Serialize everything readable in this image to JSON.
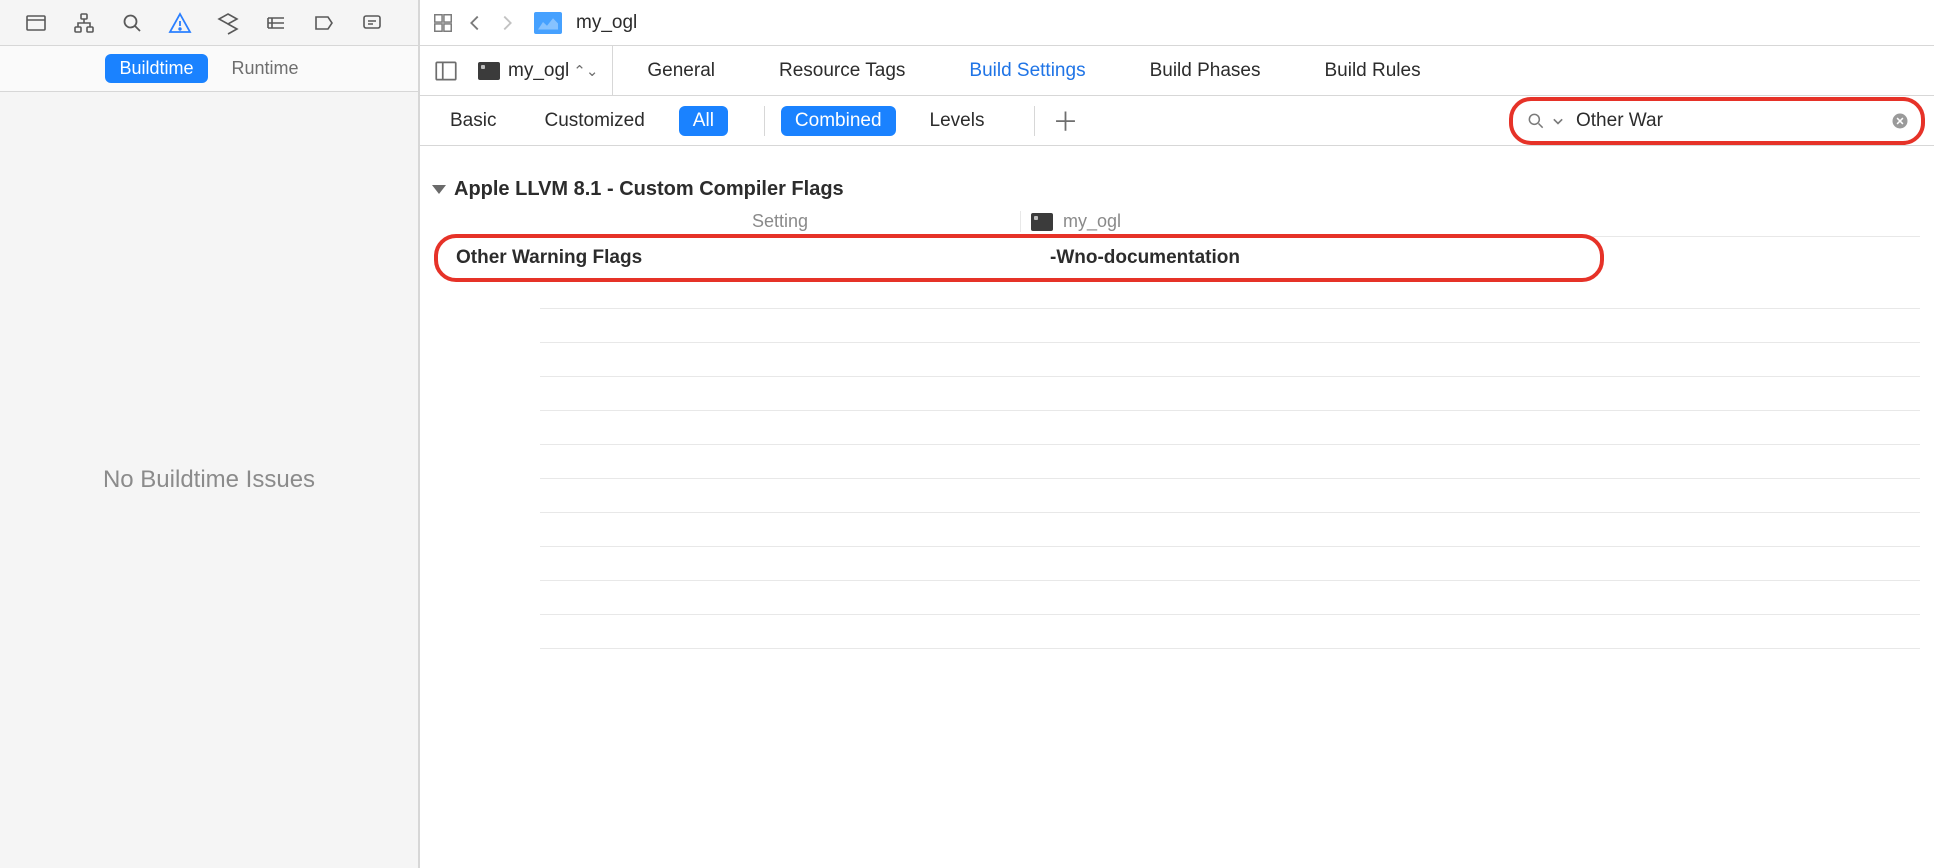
{
  "sidebar": {
    "segments": {
      "buildtime": "Buildtime",
      "runtime": "Runtime"
    },
    "active_segment": "buildtime",
    "message": "No Buildtime Issues"
  },
  "breadcrumb": {
    "file": "my_ogl"
  },
  "target": {
    "name": "my_ogl"
  },
  "project_tabs": {
    "general": "General",
    "resource_tags": "Resource Tags",
    "build_settings": "Build Settings",
    "build_phases": "Build Phases",
    "build_rules": "Build Rules",
    "active": "build_settings"
  },
  "filter": {
    "basic": "Basic",
    "customized": "Customized",
    "all": "All",
    "combined": "Combined",
    "levels": "Levels"
  },
  "search": {
    "value": "Other War"
  },
  "columns": {
    "setting": "Setting",
    "target": "my_ogl"
  },
  "group": {
    "title": "Apple LLVM 8.1 - Custom Compiler Flags"
  },
  "row": {
    "name": "Other Warning Flags",
    "value": "-Wno-documentation"
  }
}
